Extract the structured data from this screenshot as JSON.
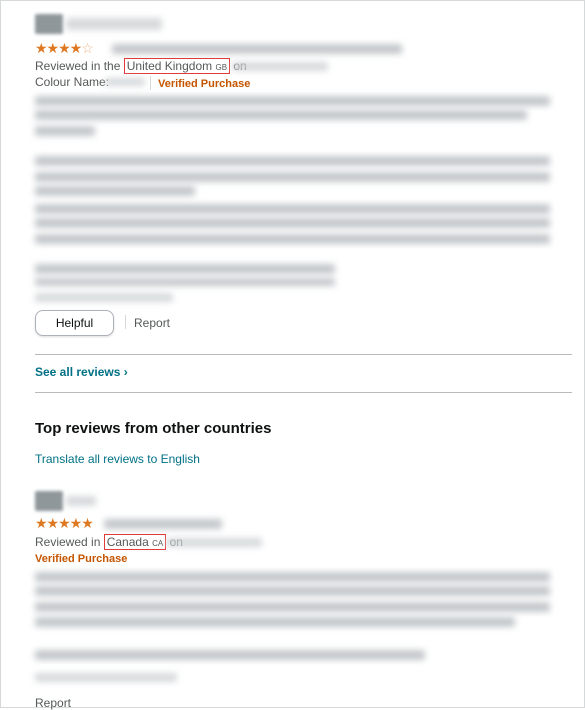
{
  "review1": {
    "rating_stars": "★★★★",
    "rating_empty_star": "☆",
    "reviewed_prefix": "Reviewed in the",
    "country": "United Kingdom",
    "country_code": "GB",
    "on": "on",
    "colour_label": "Colour Name:",
    "verified": "Verified Purchase",
    "helpful_button": "Helpful",
    "report": "Report"
  },
  "see_all_reviews": "See all reviews",
  "see_all_chevron": "›",
  "other_countries": {
    "heading": "Top reviews from other countries",
    "translate_link": "Translate all reviews to English"
  },
  "review2": {
    "rating_stars": "★★★★★",
    "reviewed_prefix": "Reviewed in",
    "country": "Canada",
    "country_code": "CA",
    "on": "on",
    "verified": "Verified Purchase",
    "report": "Report"
  }
}
